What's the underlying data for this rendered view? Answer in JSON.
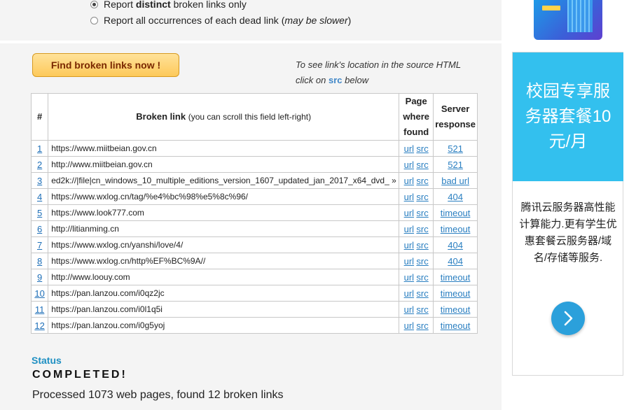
{
  "options": {
    "distinct": {
      "prefix": "Report ",
      "bold": "distinct",
      "suffix": " broken links only",
      "checked": true
    },
    "all": {
      "prefix": "Report all occurrences of each dead link (",
      "italic": "may be slower",
      "suffix": ")",
      "checked": false
    }
  },
  "find_button": {
    "label": "Find broken links now !"
  },
  "hint": {
    "line1": "To see link's location in the source HTML",
    "prefix": "click on ",
    "src": "src",
    "suffix": " below"
  },
  "table": {
    "headers": {
      "num": "#",
      "link": "Broken link",
      "link_note": "(you can scroll this field left-right)",
      "page_where_found": [
        "Page",
        "where",
        "found"
      ],
      "server_response": [
        "Server",
        "response"
      ]
    },
    "rows": [
      {
        "num": "1",
        "url": "https://www.miitbeian.gov.cn",
        "url_link": "url",
        "src_link": "src",
        "response": "521"
      },
      {
        "num": "2",
        "url": "http://www.miitbeian.gov.cn",
        "url_link": "url",
        "src_link": "src",
        "response": "521"
      },
      {
        "num": "3",
        "url": "ed2k://|file|cn_windows_10_multiple_editions_version_1607_updated_jan_2017_x64_dvd_ »",
        "url_link": "url",
        "src_link": "src",
        "response": "bad url"
      },
      {
        "num": "4",
        "url": "https://www.wxlog.cn/tag/%e4%bc%98%e5%8c%96/",
        "url_link": "url",
        "src_link": "src",
        "response": "404"
      },
      {
        "num": "5",
        "url": "https://www.look777.com",
        "url_link": "url",
        "src_link": "src",
        "response": "timeout"
      },
      {
        "num": "6",
        "url": "http://litianming.cn",
        "url_link": "url",
        "src_link": "src",
        "response": "timeout"
      },
      {
        "num": "7",
        "url": "https://www.wxlog.cn/yanshi/love/4/",
        "url_link": "url",
        "src_link": "src",
        "response": "404"
      },
      {
        "num": "8",
        "url": "https://www.wxlog.cn/http%EF%BC%9A//",
        "url_link": "url",
        "src_link": "src",
        "response": "404"
      },
      {
        "num": "9",
        "url": "http://www.loouy.com",
        "url_link": "url",
        "src_link": "src",
        "response": "timeout"
      },
      {
        "num": "10",
        "url": "https://pan.lanzou.com/i0qz2jc",
        "url_link": "url",
        "src_link": "src",
        "response": "timeout"
      },
      {
        "num": "11",
        "url": "https://pan.lanzou.com/i0l1q5i",
        "url_link": "url",
        "src_link": "src",
        "response": "timeout"
      },
      {
        "num": "12",
        "url": "https://pan.lanzou.com/i0g5yoj",
        "url_link": "url",
        "src_link": "src",
        "response": "timeout"
      }
    ]
  },
  "status": {
    "label": "Status",
    "value": "COMPLETED!",
    "summary": "Processed 1073 web pages, found 12 broken links"
  },
  "ad": {
    "headline": "校园专享服务器套餐10元/月",
    "body": "腾讯云服务器高性能计算能力.更有学生优惠套餐云服务器/域名/存储等服务.",
    "button_icon": "chevron-right-icon"
  },
  "colors": {
    "link": "#1e6fb8",
    "status_label": "#1e8fc2",
    "ad_blue": "#33c0ee",
    "button_text": "#7a2800"
  }
}
